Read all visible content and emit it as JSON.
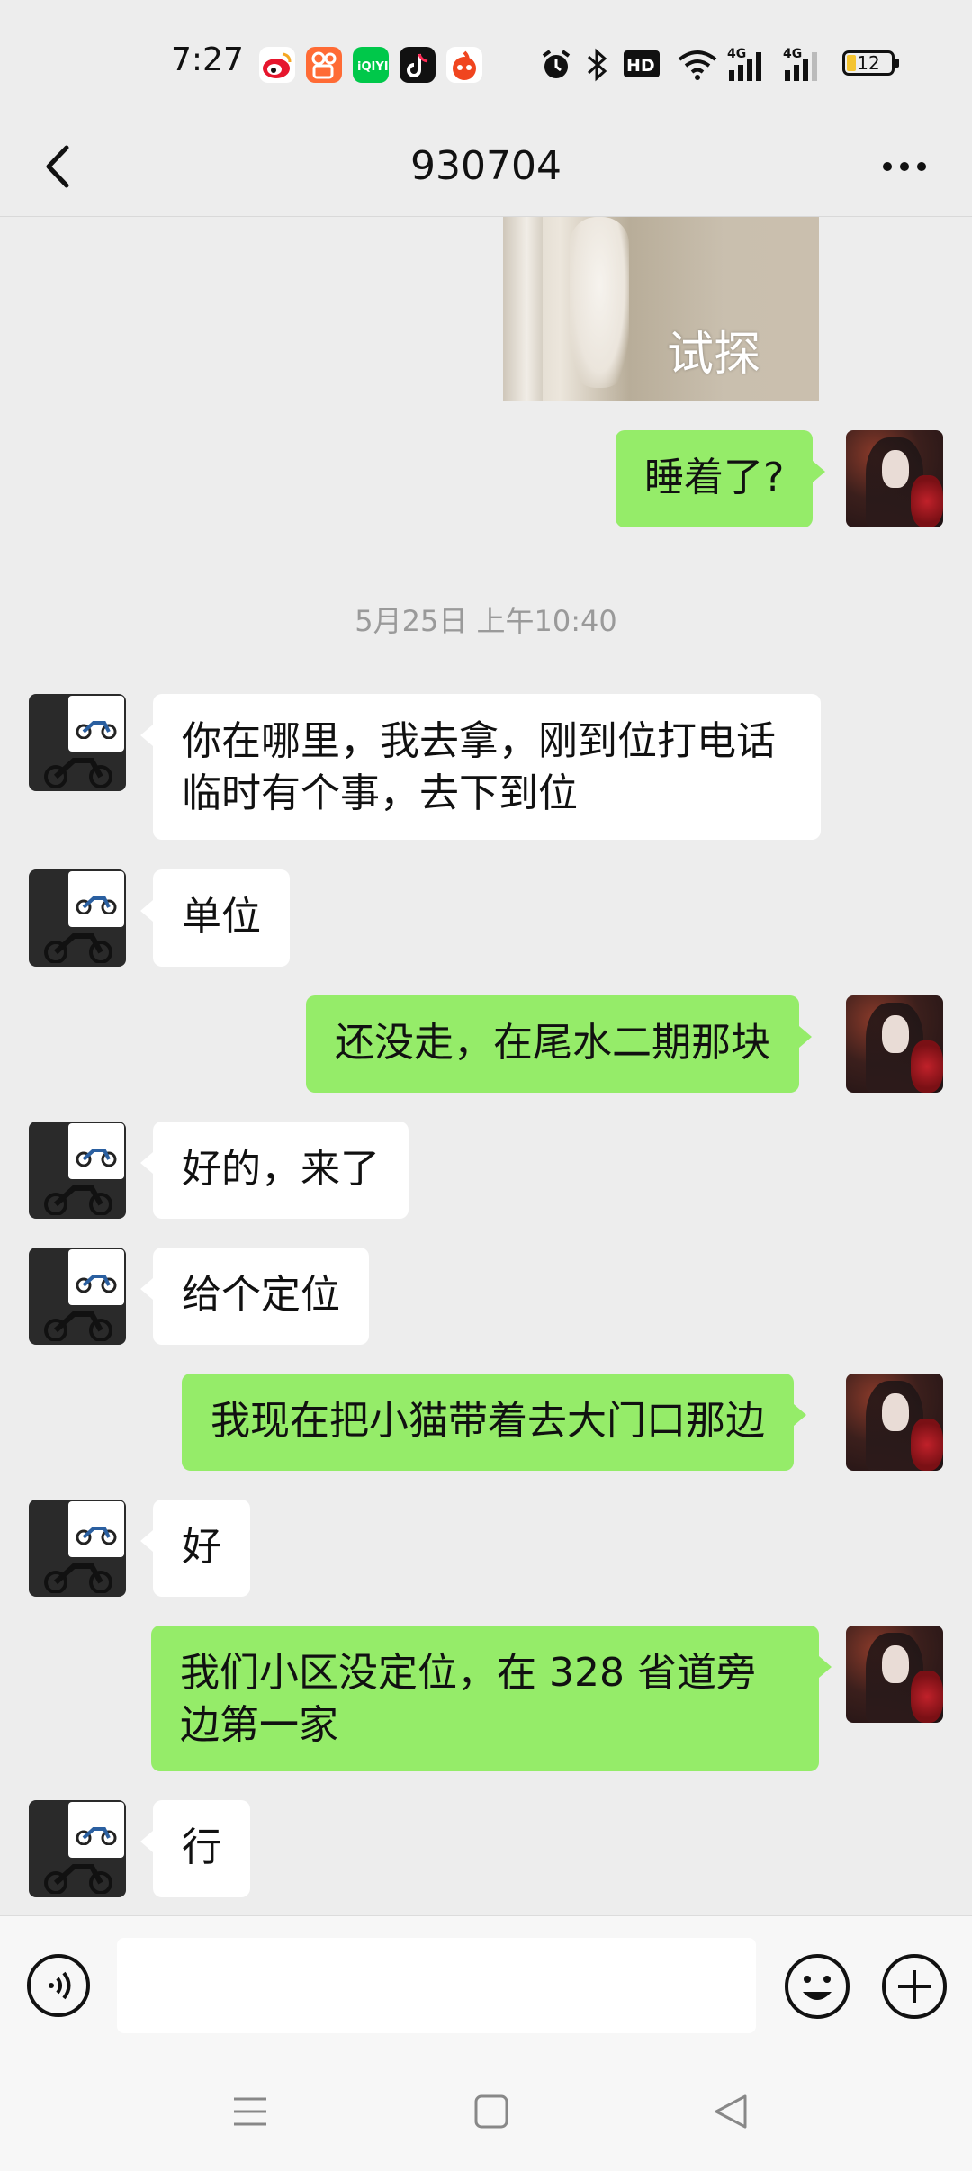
{
  "status_bar": {
    "time": "7:27",
    "battery": "12",
    "icons": [
      "weibo-icon",
      "kuaishou-icon",
      "iqiyi-icon",
      "tiktok-icon",
      "fire-icon",
      "alarm-icon",
      "bluetooth-icon",
      "hd-icon",
      "wifi-icon",
      "signal-4g-icon",
      "signal-4g-icon",
      "battery-icon"
    ]
  },
  "header": {
    "title": "930704"
  },
  "chat": {
    "sticker_caption": "试探",
    "messages": [
      {
        "side": "out",
        "text": "睡着了?"
      },
      {
        "type": "time",
        "text": "5月25日 上午10:40"
      },
      {
        "side": "in",
        "text": "你在哪里，我去拿，刚到位打电话临时有个事，去下到位"
      },
      {
        "side": "in",
        "text": "单位"
      },
      {
        "side": "out",
        "text": "还没走，在尾水二期那块"
      },
      {
        "side": "in",
        "text": "好的，来了"
      },
      {
        "side": "in",
        "text": "给个定位"
      },
      {
        "side": "out",
        "text": "我现在把小猫带着去大门口那边"
      },
      {
        "side": "in",
        "text": "好"
      },
      {
        "side": "out",
        "text": "我们小区没定位，在 328 省道旁边第一家"
      },
      {
        "side": "in",
        "text": "行"
      }
    ]
  },
  "input_bar": {
    "placeholder": "",
    "value": ""
  },
  "colors": {
    "outgoing_bubble": "#95ec69",
    "incoming_bubble": "#ffffff",
    "background": "#ededed"
  }
}
